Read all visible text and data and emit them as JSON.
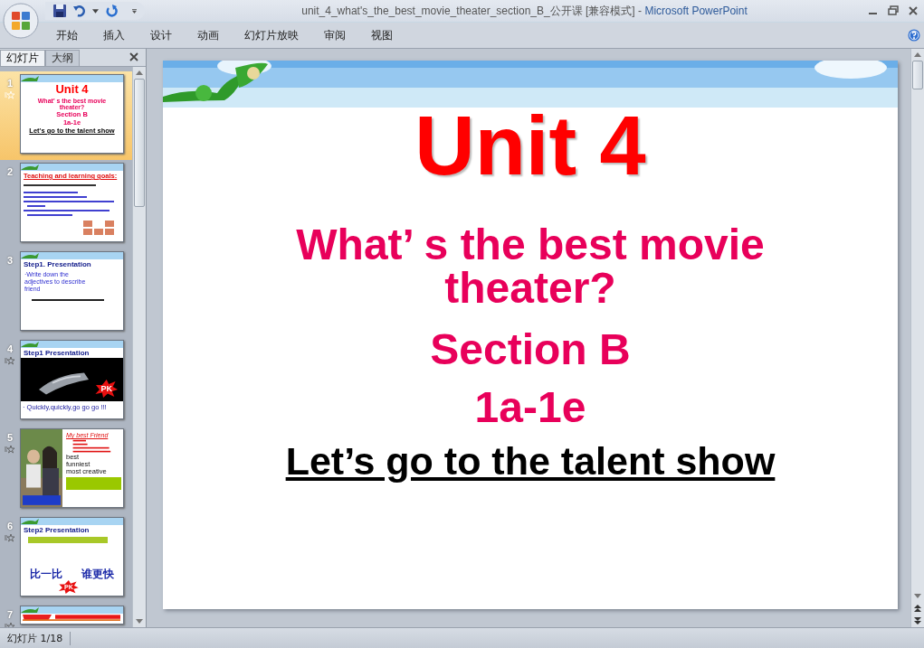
{
  "window": {
    "title_file": "unit_4_what's_the_best_movie_theater_section_B_公开课 [兼容模式]",
    "title_separator": "-",
    "title_app": "Microsoft PowerPoint"
  },
  "ribbon_tabs": [
    {
      "label": "开始"
    },
    {
      "label": "插入"
    },
    {
      "label": "设计"
    },
    {
      "label": "动画"
    },
    {
      "label": "幻灯片放映"
    },
    {
      "label": "审阅"
    },
    {
      "label": "视图"
    }
  ],
  "pane_tabs": [
    {
      "label": "幻灯片",
      "selected": true
    },
    {
      "label": "大纲",
      "selected": false
    }
  ],
  "thumbnails": [
    {
      "number": "1",
      "animated": true,
      "selected": true,
      "kind": "title",
      "texts": [
        "Unit 4",
        "What’ s the best movie theater?",
        "Section B",
        "1a-1e",
        "Let's go to the talent show"
      ]
    },
    {
      "number": "2",
      "animated": false,
      "selected": false,
      "kind": "goals",
      "texts": [
        "Teaching and learning goals:"
      ]
    },
    {
      "number": "3",
      "animated": false,
      "selected": false,
      "kind": "step",
      "texts": [
        "Step1. Presentation",
        "·Write down the adjectives to describe friend"
      ]
    },
    {
      "number": "4",
      "animated": true,
      "selected": false,
      "kind": "pk",
      "texts": [
        "Step1 Presentation",
        "PK",
        "· Quickly,quickly,go go go !!!"
      ]
    },
    {
      "number": "5",
      "animated": true,
      "selected": false,
      "texts": [
        "My best Friend",
        "best",
        "funniest",
        "most creative"
      ]
    },
    {
      "number": "6",
      "animated": true,
      "selected": false,
      "kind": "compare",
      "texts": [
        "Step2 Presentation",
        "比一比",
        "谁更快",
        "PK"
      ]
    },
    {
      "number": "7",
      "animated": true,
      "selected": false,
      "kind": "cut"
    }
  ],
  "slide": {
    "title": "Unit 4",
    "subtitle": "What’ s the best movie theater?",
    "section": "Section B",
    "parts": "1a-1e",
    "tagline": "Let’s go to the talent show"
  },
  "status_bar": {
    "slide_counter": "幻灯片 1/18"
  }
}
